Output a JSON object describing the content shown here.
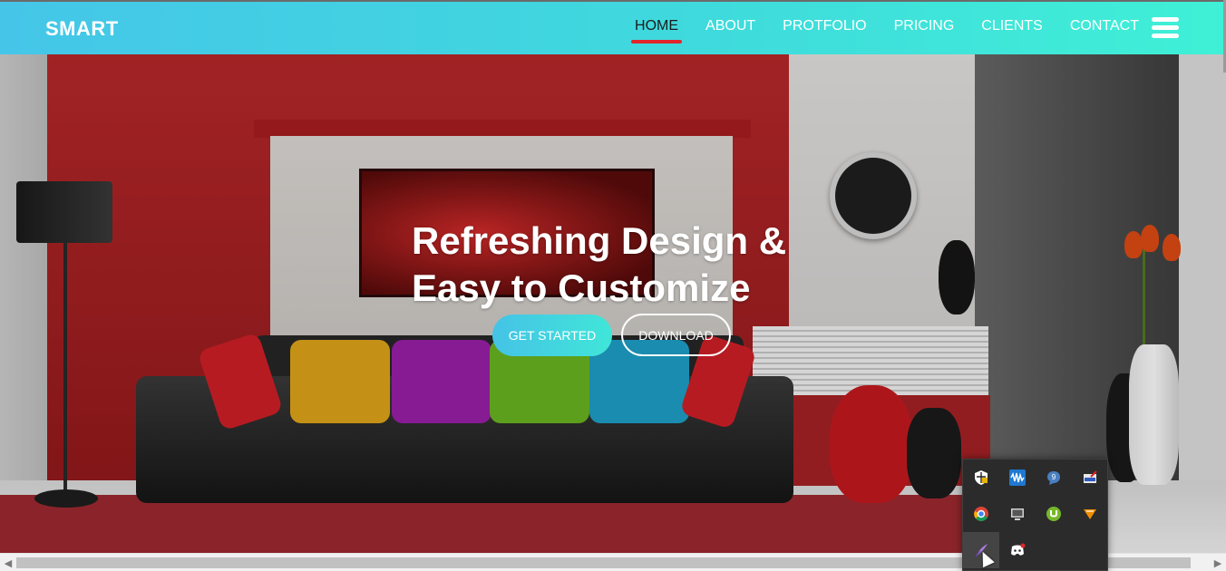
{
  "brand": "SMART",
  "nav": {
    "items": [
      {
        "label": "HOME",
        "active": true
      },
      {
        "label": "ABOUT"
      },
      {
        "label": "PROTFOLIO"
      },
      {
        "label": "PRICING"
      },
      {
        "label": "CLIENTS"
      },
      {
        "label": "CONTACT"
      }
    ],
    "menu_icon": "hamburger-menu-icon"
  },
  "hero": {
    "title_line1": "Refreshing Design &",
    "title_line2": "Easy to Customize",
    "primary_button": "GET STARTED",
    "secondary_button": "DOWNLOAD"
  },
  "colors": {
    "header_gradient_start": "#45c6e8",
    "header_gradient_end": "#3ff0d6",
    "active_underline": "#e0262b",
    "button_gradient_start": "#45c3e6",
    "button_gradient_end": "#40e6d8",
    "tray_background": "#2b2b2b"
  },
  "tray": {
    "icons": [
      "security-shield-icon",
      "audio-waveform-icon",
      "chat-bubble-icon",
      "network-adapter-icon",
      "chrome-icon",
      "monitor-icon",
      "utorrent-icon",
      "vlc-icon",
      "quill-pen-icon",
      "discord-icon"
    ]
  }
}
